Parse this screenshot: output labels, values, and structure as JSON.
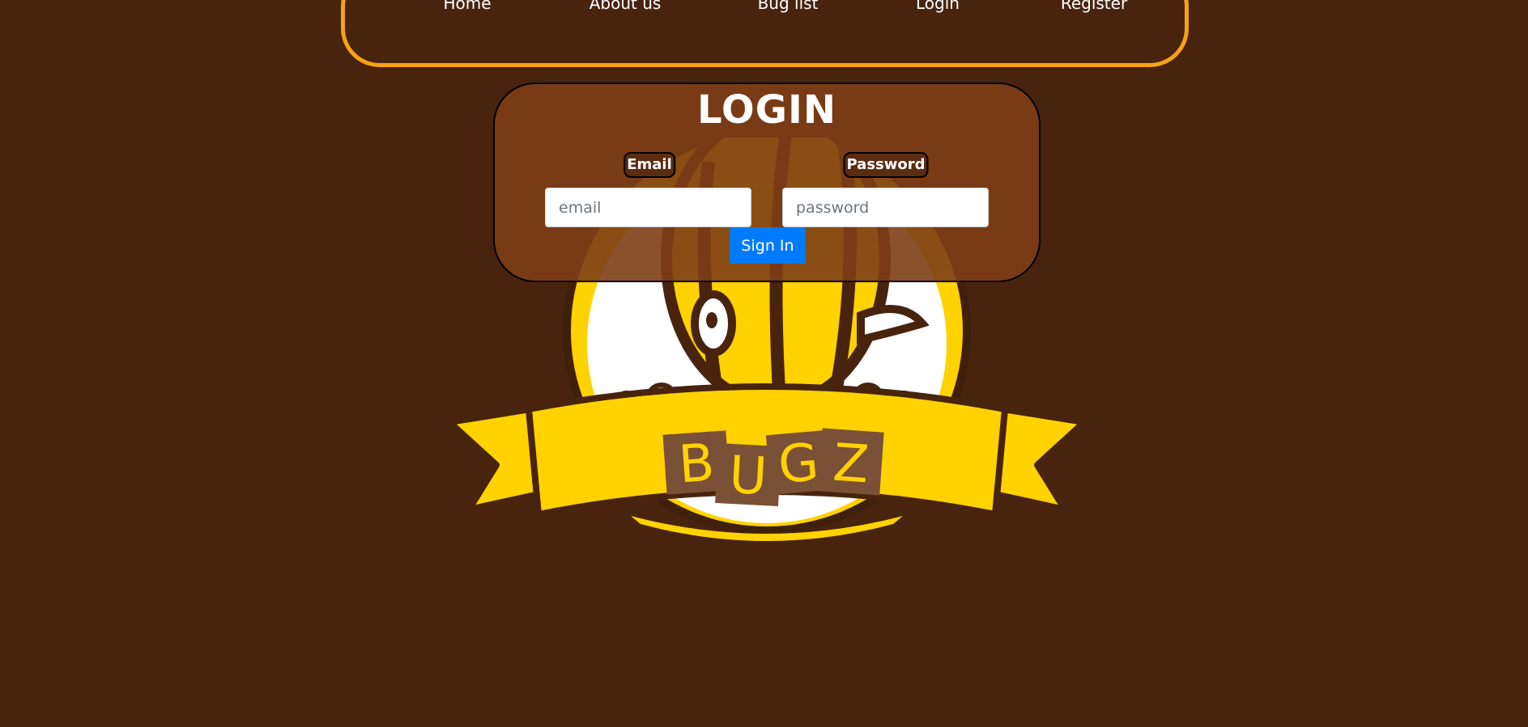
{
  "nav": {
    "items": [
      {
        "label": "Home"
      },
      {
        "label": "About us"
      },
      {
        "label": "Bug list"
      },
      {
        "label": "Login"
      },
      {
        "label": "Register"
      }
    ]
  },
  "login": {
    "title": "LOGIN",
    "email_label": "Email",
    "email_placeholder": "email",
    "email_value": "",
    "password_label": "Password",
    "password_placeholder": "password",
    "password_value": "",
    "signin_label": "Sign In"
  },
  "logo": {
    "name": "bugz-bee-logo",
    "letters": [
      "B",
      "U",
      "G",
      "Z"
    ]
  },
  "colors": {
    "background": "#48240f",
    "nav_border": "#f5a214",
    "card": "#7d3e16",
    "button": "#007bff",
    "logo_yellow": "#ffd200",
    "logo_dark": "#48240f",
    "logo_tile": "#7a5036"
  }
}
